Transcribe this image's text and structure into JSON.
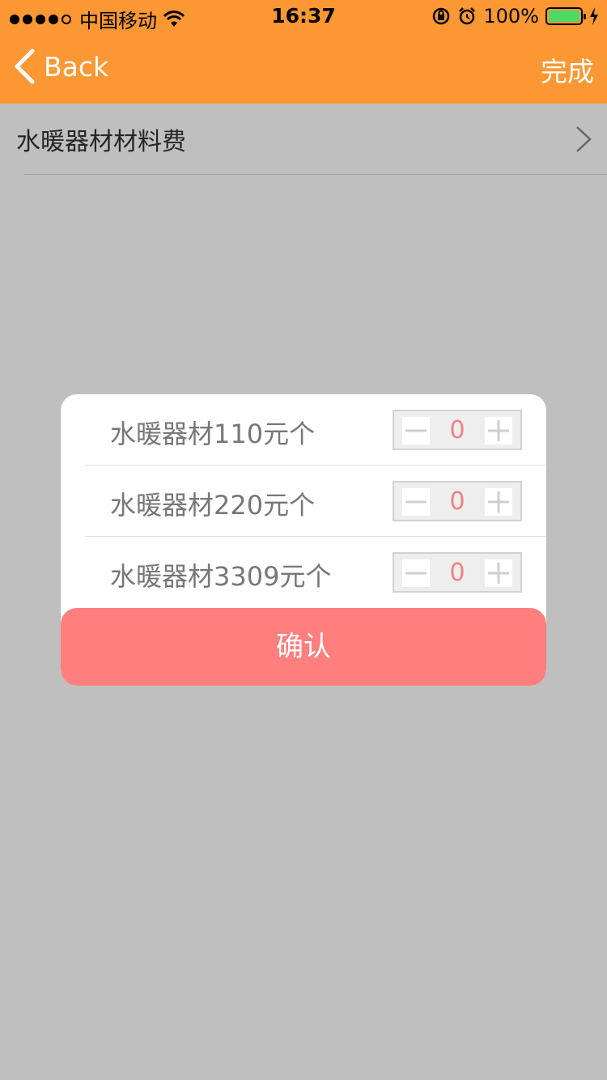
{
  "status_bar": {
    "carrier": "中国移动",
    "time": "16:37",
    "battery": "100%"
  },
  "nav": {
    "back_label": "Back",
    "done_label": "完成"
  },
  "list": {
    "items": [
      {
        "label": "水暖器材材料费"
      }
    ]
  },
  "modal": {
    "items": [
      {
        "name": "水暖器材110元个",
        "quantity": "0"
      },
      {
        "name": "水暖器材220元个",
        "quantity": "0"
      },
      {
        "name": "水暖器材3309元个",
        "quantity": "0"
      }
    ],
    "confirm_label": "确认"
  },
  "colors": {
    "nav_bg": "#fc9834",
    "confirm_bg": "#ff7f7f",
    "quantity_text": "#f08080",
    "battery_fill": "#4cd964"
  }
}
